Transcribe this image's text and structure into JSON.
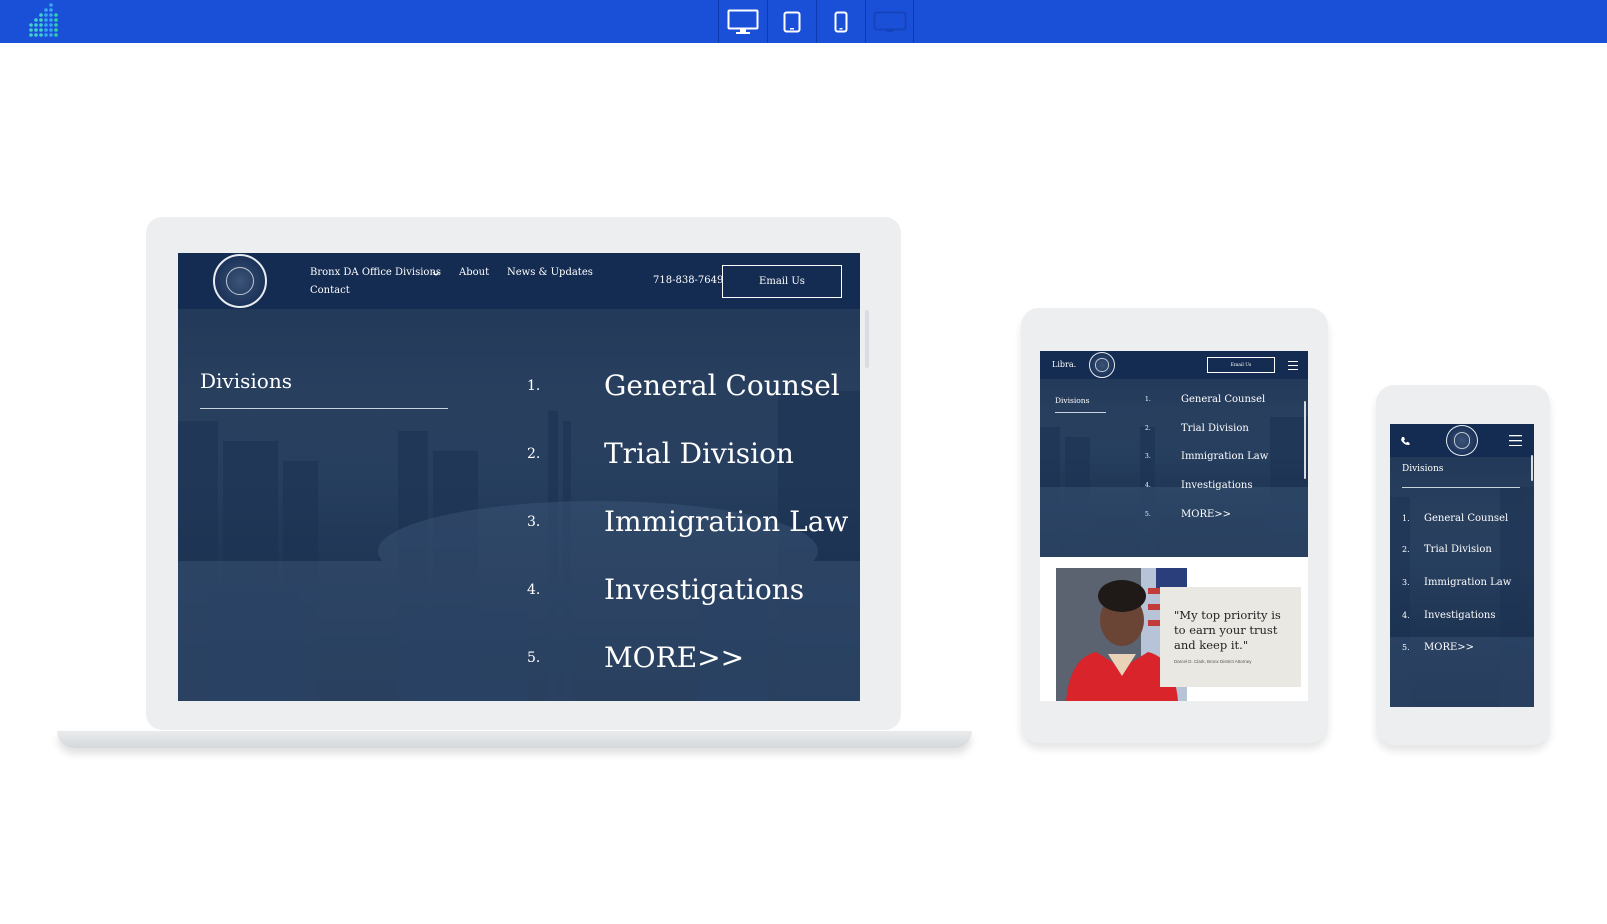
{
  "colors": {
    "topbar": "#1a4fd8",
    "site_navy": "#142c52",
    "device_frame": "#eceef0"
  },
  "toolbar": {
    "logo_icon": "signal-dots-icon",
    "devices": [
      {
        "name": "desktop",
        "icon": "desktop-icon"
      },
      {
        "name": "tablet",
        "icon": "tablet-icon"
      },
      {
        "name": "phone",
        "icon": "phone-icon"
      },
      {
        "name": "wide",
        "icon": "landscape-icon"
      }
    ]
  },
  "laptop": {
    "nav": {
      "menu_divisions": "Bronx DA Office Divisions",
      "menu_about": "About",
      "menu_news": "News & Updates",
      "menu_contact": "Contact",
      "phone": "718-838-7649",
      "email_button": "Email Us"
    },
    "divisions_title": "Divisions",
    "divisions": [
      {
        "num": "1.",
        "name": "General Counsel"
      },
      {
        "num": "2.",
        "name": "Trial Division"
      },
      {
        "num": "3.",
        "name": "Immigration Law"
      },
      {
        "num": "4.",
        "name": "Investigations"
      },
      {
        "num": "5.",
        "name": "MORE>>"
      }
    ]
  },
  "tablet": {
    "brand": "Libra.",
    "email_button": "Email Us",
    "divisions_title": "Divisions",
    "divisions": [
      {
        "num": "1.",
        "name": "General Counsel"
      },
      {
        "num": "2.",
        "name": "Trial Division"
      },
      {
        "num": "3.",
        "name": "Immigration Law"
      },
      {
        "num": "4.",
        "name": "Investigations"
      },
      {
        "num": "5.",
        "name": "MORE>>"
      }
    ],
    "quote": "\"My top priority is to earn your trust and keep it.\"",
    "quote_attribution": "Darcel D. Clark, Bronx District Attorney"
  },
  "phone": {
    "divisions_title": "Divisions",
    "divisions": [
      {
        "num": "1.",
        "name": "General Counsel"
      },
      {
        "num": "2.",
        "name": "Trial Division"
      },
      {
        "num": "3.",
        "name": "Immigration Law"
      },
      {
        "num": "4.",
        "name": "Investigations"
      },
      {
        "num": "5.",
        "name": "MORE>>"
      }
    ]
  }
}
